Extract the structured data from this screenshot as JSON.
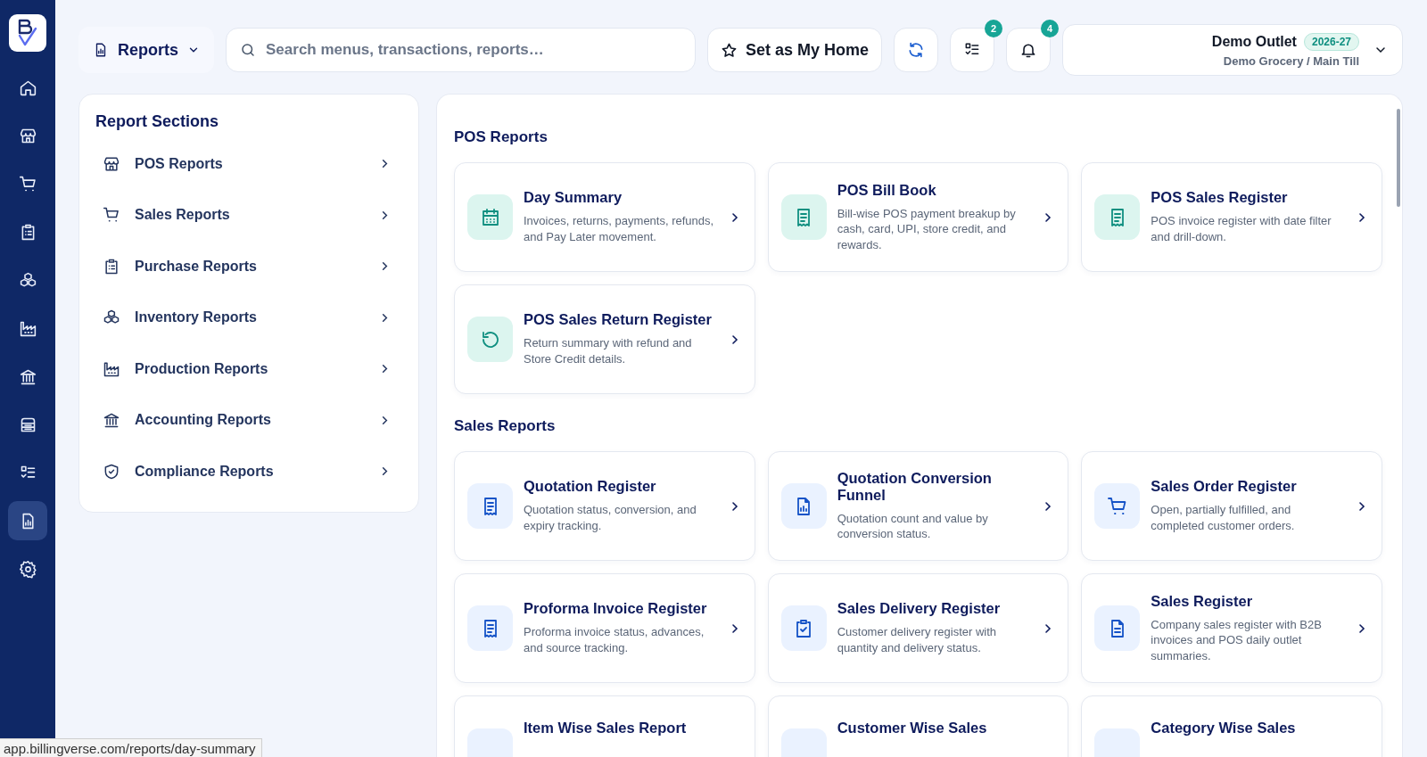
{
  "nav": [
    {
      "selected": false
    },
    {
      "selected": false
    },
    {
      "selected": false
    },
    {
      "selected": false
    },
    {
      "selected": false
    },
    {
      "selected": false
    },
    {
      "selected": false
    },
    {
      "selected": false
    },
    {
      "selected": false
    },
    {
      "selected": true
    },
    {
      "selected": false
    }
  ],
  "top_bar": {
    "module_menu": {
      "label": "Reports"
    },
    "search": {
      "placeholder": "Search menus, transactions, reports…"
    },
    "home_button": {
      "label": "Set as My Home"
    },
    "tasks_badge": "2",
    "notifications_badge": "4",
    "outlet": {
      "name": "Demo Outlet",
      "year": "2026-27",
      "subtitle": "Demo Grocery / Main Till"
    }
  },
  "report_sections": {
    "title": "Report Sections",
    "items": [
      {
        "label": "POS Reports"
      },
      {
        "label": "Sales Reports"
      },
      {
        "label": "Purchase Reports"
      },
      {
        "label": "Inventory Reports"
      },
      {
        "label": "Production Reports"
      },
      {
        "label": "Accounting Reports"
      },
      {
        "label": "Compliance Reports"
      }
    ]
  },
  "sections": [
    {
      "title": "POS Reports",
      "color": "#0f8f80",
      "cards": [
        {
          "title": "Day Summary",
          "description": "Invoices, returns, payments, refunds, and Pay Later movement."
        },
        {
          "title": "POS Bill Book",
          "description": "Bill-wise POS payment breakup by cash, card, UPI, store credit, and rewards."
        },
        {
          "title": "POS Sales Register",
          "description": "POS invoice register with date filter and drill-down."
        },
        {
          "title": "POS Sales Return Register",
          "description": "Return summary with refund and Store Credit details."
        }
      ]
    },
    {
      "title": "Sales Reports",
      "color": "#1553c7",
      "cards": [
        {
          "title": "Quotation Register",
          "description": "Quotation status, conversion, and expiry tracking."
        },
        {
          "title": "Quotation Conversion Funnel",
          "description": "Quotation count and value by conversion status."
        },
        {
          "title": "Sales Order Register",
          "description": "Open, partially fulfilled, and completed customer orders."
        },
        {
          "title": "Proforma Invoice Register",
          "description": "Proforma invoice status, advances, and source tracking."
        },
        {
          "title": "Sales Delivery Register",
          "description": "Customer delivery register with quantity and delivery status."
        },
        {
          "title": "Sales Register",
          "description": "Company sales register with B2B invoices and POS daily outlet summaries."
        },
        {
          "title": "Item Wise Sales Report"
        },
        {
          "title": "Customer Wise Sales"
        },
        {
          "title": "Category Wise Sales"
        }
      ]
    }
  ],
  "status_bar": {
    "url": "app.billingverse.com/reports/day-summary"
  }
}
